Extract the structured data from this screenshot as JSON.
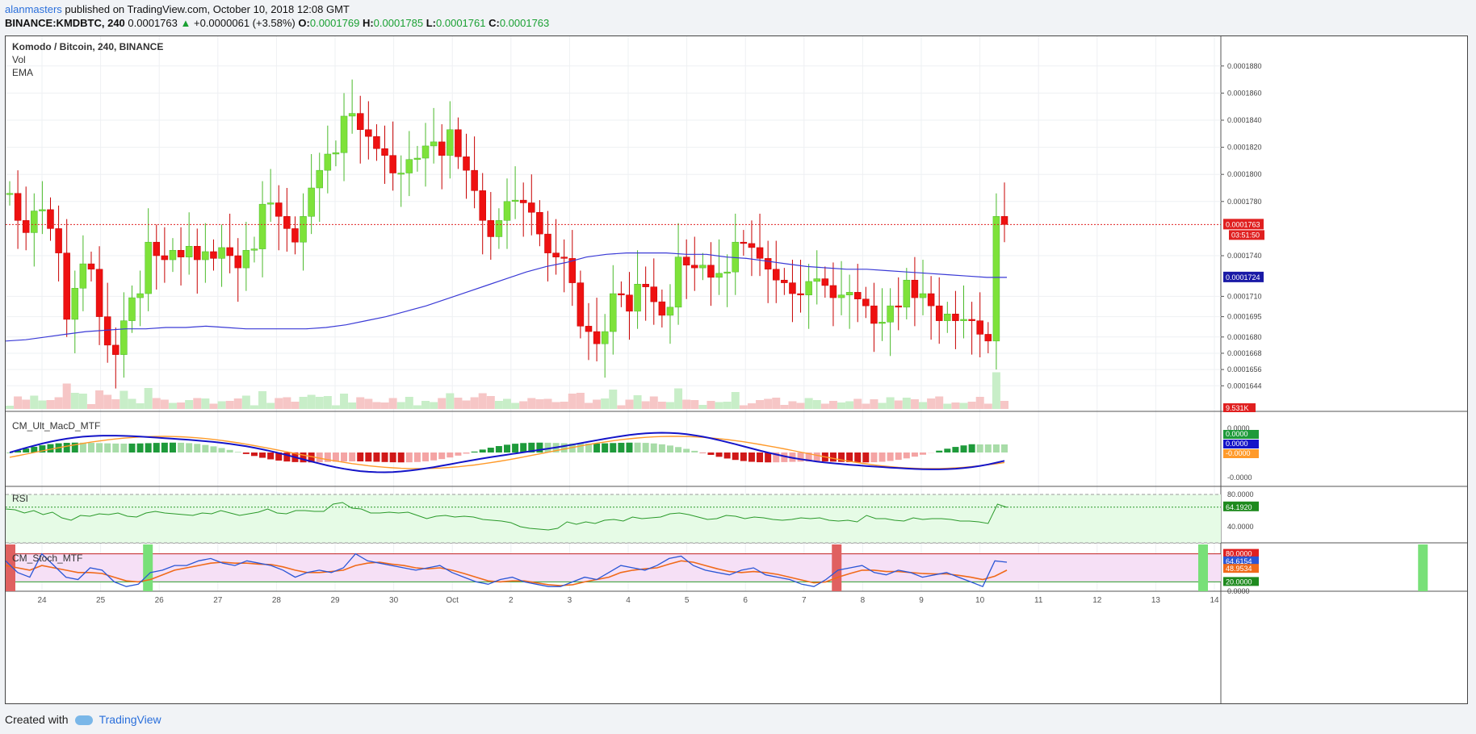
{
  "header": {
    "user": "alanmasters",
    "published": " published on TradingView.com, October 10, 2018 12:08 GMT",
    "symbol": "BINANCE:KMDBTC, 240",
    "last": "0.0001763",
    "change": "+0.0000061 (+3.58%)",
    "o_label": "O:",
    "o": "0.0001769",
    "h_label": "H:",
    "h": "0.0001785",
    "l_label": "L:",
    "l": "0.0001761",
    "c_label": "C:",
    "c": "0.0001763"
  },
  "panes": {
    "main_title": "Komodo / Bitcoin, 240, BINANCE",
    "vol": "Vol",
    "ema": "EMA",
    "macd": "CM_Ult_MacD_MTF",
    "rsi": "RSI",
    "stoch": "CM_Stoch_MTF"
  },
  "footer": {
    "created": "Created with",
    "brand": "TradingView"
  },
  "colors": {
    "up": "#7ee23a",
    "down": "#ee1111",
    "ema": "#3a3ad6",
    "grid": "#eef0f3"
  },
  "chart_data": [
    {
      "type": "candlestick",
      "title": "Komodo / Bitcoin, 240, BINANCE",
      "x_ticks": [
        "24",
        "25",
        "26",
        "27",
        "28",
        "29",
        "30",
        "Oct",
        "2",
        "3",
        "4",
        "5",
        "6",
        "7",
        "8",
        "9",
        "10",
        "11",
        "12",
        "13",
        "14"
      ],
      "y_ticks": [
        "0.0001880",
        "0.0001860",
        "0.0001840",
        "0.0001820",
        "0.0001800",
        "0.0001780",
        "0.0001740",
        "0.0001710",
        "0.0001695",
        "0.0001680",
        "0.0001668",
        "0.0001656",
        "0.0001644"
      ],
      "ylim": [
        0.000164,
        0.000189
      ],
      "last_price_label": "0.0001763",
      "countdown": "03:51:50",
      "ema_label": "0.0001724",
      "volume_label": "9.531K",
      "closes": [
        0.0001786,
        0.0001766,
        0.0001757,
        0.0001773,
        0.0001774,
        0.000176,
        0.0001742,
        0.0001693,
        0.0001716,
        0.0001734,
        0.000173,
        0.0001695,
        0.0001674,
        0.0001667,
        0.0001692,
        0.0001709,
        0.0001712,
        0.000175,
        0.000174,
        0.0001737,
        0.0001744,
        0.0001739,
        0.0001747,
        0.0001737,
        0.0001743,
        0.0001738,
        0.0001746,
        0.000174,
        0.0001731,
        0.0001744,
        0.0001745,
        0.0001778,
        0.0001779,
        0.0001769,
        0.000176,
        0.000175,
        0.0001769,
        0.000179,
        0.0001803,
        0.0001815,
        0.0001816,
        0.0001843,
        0.0001845,
        0.0001833,
        0.0001828,
        0.0001819,
        0.0001814,
        0.0001801,
        0.0001801,
        0.0001811,
        0.0001812,
        0.0001821,
        0.0001824,
        0.0001814,
        0.0001833,
        0.0001813,
        0.0001803,
        0.0001788,
        0.0001766,
        0.0001754,
        0.0001766,
        0.000178,
        0.0001781,
        0.0001779,
        0.0001772,
        0.0001756,
        0.0001742,
        0.0001739,
        0.0001738,
        0.000172,
        0.0001688,
        0.0001684,
        0.0001675,
        0.0001684,
        0.0001712,
        0.0001711,
        0.0001699,
        0.0001719,
        0.0001717,
        0.0001706,
        0.0001696,
        0.0001702,
        0.0001739,
        0.0001733,
        0.0001731,
        0.0001733,
        0.0001724,
        0.0001727,
        0.0001728,
        0.000175,
        0.0001749,
        0.0001746,
        0.0001738,
        0.000173,
        0.0001722,
        0.000172,
        0.0001712,
        0.0001711,
        0.0001721,
        0.0001723,
        0.0001718,
        0.0001709,
        0.0001711,
        0.0001713,
        0.0001708,
        0.0001703,
        0.000169,
        0.0001691,
        0.0001703,
        0.0001702,
        0.0001722,
        0.0001709,
        0.0001712,
        0.0001703,
        0.0001692,
        0.0001697,
        0.0001692,
        0.0001693,
        0.0001692,
        0.0001682,
        0.0001677,
        0.0001769,
        0.0001763
      ],
      "ema_values": [
        0.0001677,
        0.0001678,
        0.000168,
        0.0001682,
        0.0001684,
        0.0001685,
        0.0001686,
        0.0001686,
        0.0001687,
        0.0001687,
        0.0001688,
        0.0001687,
        0.0001686,
        0.0001686,
        0.0001686,
        0.0001686,
        0.0001687,
        0.0001689,
        0.0001692,
        0.0001695,
        0.0001699,
        0.0001703,
        0.0001708,
        0.0001713,
        0.0001718,
        0.0001723,
        0.0001728,
        0.0001732,
        0.0001735,
        0.0001739,
        0.0001741,
        0.0001742,
        0.0001742,
        0.0001742,
        0.0001741,
        0.0001741,
        0.0001739,
        0.0001738,
        0.0001736,
        0.0001734,
        0.0001732,
        0.0001731,
        0.000173,
        0.000173,
        0.0001729,
        0.0001728,
        0.0001727,
        0.0001726,
        0.0001725,
        0.0001724,
        0.0001724
      ]
    },
    {
      "type": "bar",
      "title": "CM_Ult_MacD_MTF",
      "y_ticks": [
        "0.0000",
        "-0.0000"
      ],
      "labels": [
        "0.0000",
        "0.0000",
        "-0.0000"
      ]
    },
    {
      "type": "line",
      "title": "RSI",
      "y_ticks": [
        "80.0000",
        "40.0000"
      ],
      "ylim": [
        20,
        90
      ],
      "last_label": "64.1920",
      "values": [
        62,
        61,
        57,
        60,
        55,
        58,
        51,
        48,
        54,
        53,
        56,
        55,
        57,
        53,
        52,
        57,
        59,
        57,
        56,
        55,
        54,
        57,
        56,
        60,
        57,
        54,
        56,
        58,
        62,
        57,
        56,
        60,
        60,
        59,
        59,
        68,
        70,
        63,
        62,
        57,
        57,
        58,
        57,
        58,
        54,
        50,
        53,
        54,
        52,
        53,
        52,
        49,
        48,
        47,
        45,
        40,
        38,
        37,
        36,
        38,
        46,
        43,
        46,
        44,
        48,
        49,
        47,
        52,
        50,
        51,
        52,
        56,
        57,
        55,
        52,
        49,
        50,
        54,
        53,
        50,
        52,
        51,
        49,
        48,
        49,
        51,
        50,
        51,
        48,
        47,
        48,
        46,
        54,
        50,
        50,
        48,
        47,
        51,
        49,
        50,
        50,
        49,
        47,
        47,
        46,
        44,
        68,
        64
      ]
    },
    {
      "type": "line",
      "title": "CM_Stoch_MTF",
      "y_ticks": [
        "80.0000",
        "20.0000",
        "0.0000"
      ],
      "ylim": [
        0,
        100
      ],
      "labels": [
        "64.6154",
        "48.9534",
        "20.0000"
      ],
      "k_values": [
        65,
        40,
        30,
        80,
        55,
        30,
        25,
        50,
        45,
        20,
        10,
        15,
        40,
        45,
        55,
        55,
        65,
        70,
        60,
        55,
        65,
        60,
        55,
        45,
        30,
        40,
        45,
        40,
        50,
        80,
        65,
        60,
        55,
        50,
        45,
        50,
        55,
        40,
        30,
        20,
        15,
        25,
        30,
        20,
        15,
        10,
        10,
        20,
        30,
        25,
        40,
        55,
        50,
        45,
        55,
        70,
        75,
        55,
        45,
        40,
        35,
        45,
        50,
        35,
        30,
        25,
        15,
        10,
        25,
        45,
        50,
        55,
        40,
        35,
        45,
        40,
        30,
        35,
        40,
        30,
        20,
        10,
        65,
        62
      ],
      "d_values": [
        55,
        50,
        45,
        55,
        50,
        45,
        40,
        40,
        38,
        30,
        22,
        20,
        25,
        35,
        45,
        50,
        55,
        60,
        62,
        60,
        60,
        58,
        57,
        52,
        45,
        40,
        40,
        42,
        45,
        55,
        60,
        62,
        58,
        55,
        50,
        48,
        50,
        45,
        38,
        30,
        22,
        20,
        22,
        22,
        18,
        14,
        12,
        14,
        20,
        25,
        30,
        40,
        45,
        48,
        50,
        58,
        65,
        62,
        55,
        48,
        42,
        40,
        42,
        40,
        36,
        30,
        24,
        18,
        20,
        30,
        38,
        45,
        45,
        42,
        42,
        40,
        38,
        37,
        37,
        34,
        30,
        25,
        32,
        45
      ]
    }
  ]
}
